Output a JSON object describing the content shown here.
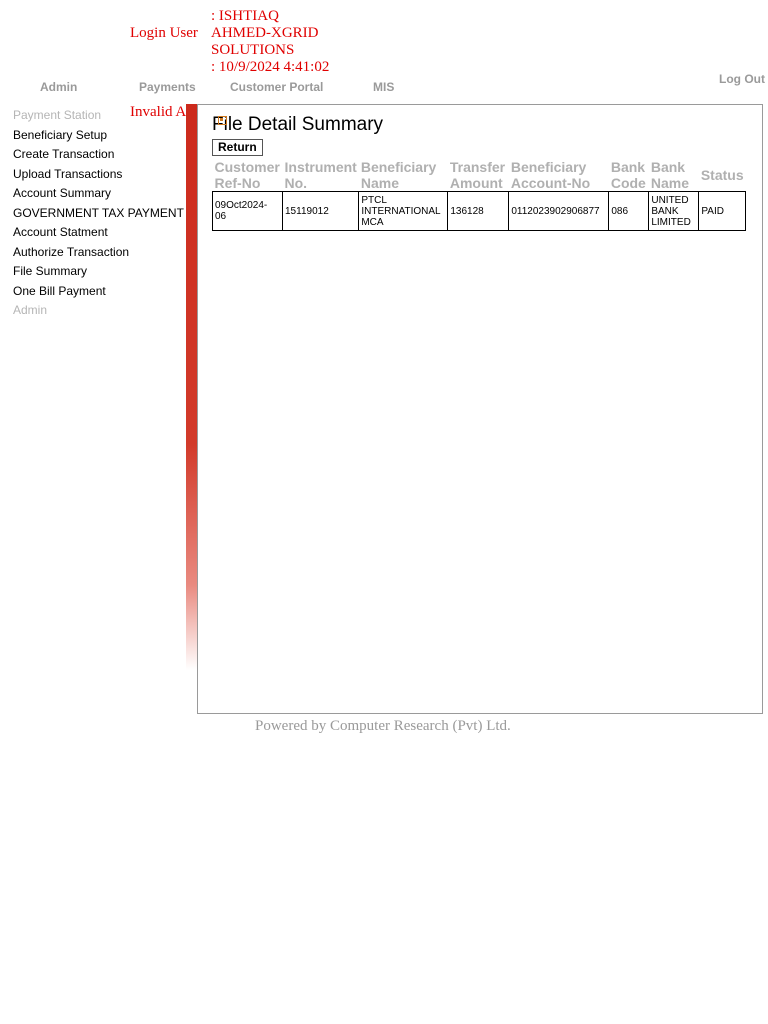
{
  "header": {
    "login_label": "Login User",
    "user_name_line1": ": ISHTIAQ",
    "user_name_line2": "AHMED-XGRID",
    "user_name_line3": "SOLUTIONS",
    "login_time": ": 10/9/2024 4:41:02",
    "logout": "Log Out"
  },
  "nav": {
    "admin": "Admin",
    "payments": "Payments",
    "customer_portal": "Customer Portal",
    "mis": "MIS"
  },
  "invalid_attempt": "Invalid Attempt(s)",
  "sidebar": {
    "items": [
      {
        "label": "Payment Station"
      },
      {
        "label": "Beneficiary Setup"
      },
      {
        "label": "Create Transaction"
      },
      {
        "label": "Upload Transactions"
      },
      {
        "label": "Account Summary"
      },
      {
        "label": "GOVERNMENT TAX PAYMENT"
      },
      {
        "label": "Account Statment"
      },
      {
        "label": "Authorize Transaction"
      },
      {
        "label": "File Summary"
      },
      {
        "label": "One Bill Payment"
      },
      {
        "label": "Admin"
      }
    ]
  },
  "main": {
    "title": "File Detail Summary",
    "return_label": "Return",
    "columns": [
      {
        "line1": "Customer",
        "line2": "Ref-No"
      },
      {
        "line1": "Instrument",
        "line2": "No."
      },
      {
        "line1": "Beneficiary",
        "line2": "Name"
      },
      {
        "line1": "Transfer",
        "line2": "Amount"
      },
      {
        "line1": "Beneficiary",
        "line2": "Account-No"
      },
      {
        "line1": "Bank",
        "line2": "Code"
      },
      {
        "line1": "Bank",
        "line2": "Name"
      },
      {
        "line1": "Status",
        "line2": ""
      }
    ],
    "rows": [
      {
        "customer_ref_line1": "09Oct2024-",
        "customer_ref_line2": "06",
        "instrument_no": "15119012",
        "beneficiary_line1": "PTCL",
        "beneficiary_line2": "INTERNATIONAL",
        "beneficiary_line3": "MCA",
        "transfer_amount": "136128",
        "account_no": "0112023902906877",
        "bank_code": "086",
        "bank_name_line1": "UNITED",
        "bank_name_line2": "BANK",
        "bank_name_line3": "LIMITED",
        "status": "PAID"
      }
    ]
  },
  "footer": {
    "text": "Powered by Computer Research (Pvt) Ltd."
  },
  "colors": {
    "accent_red": "#e00000",
    "bar_red": "#cc2a1c",
    "muted_gray": "#9a9a9a"
  }
}
